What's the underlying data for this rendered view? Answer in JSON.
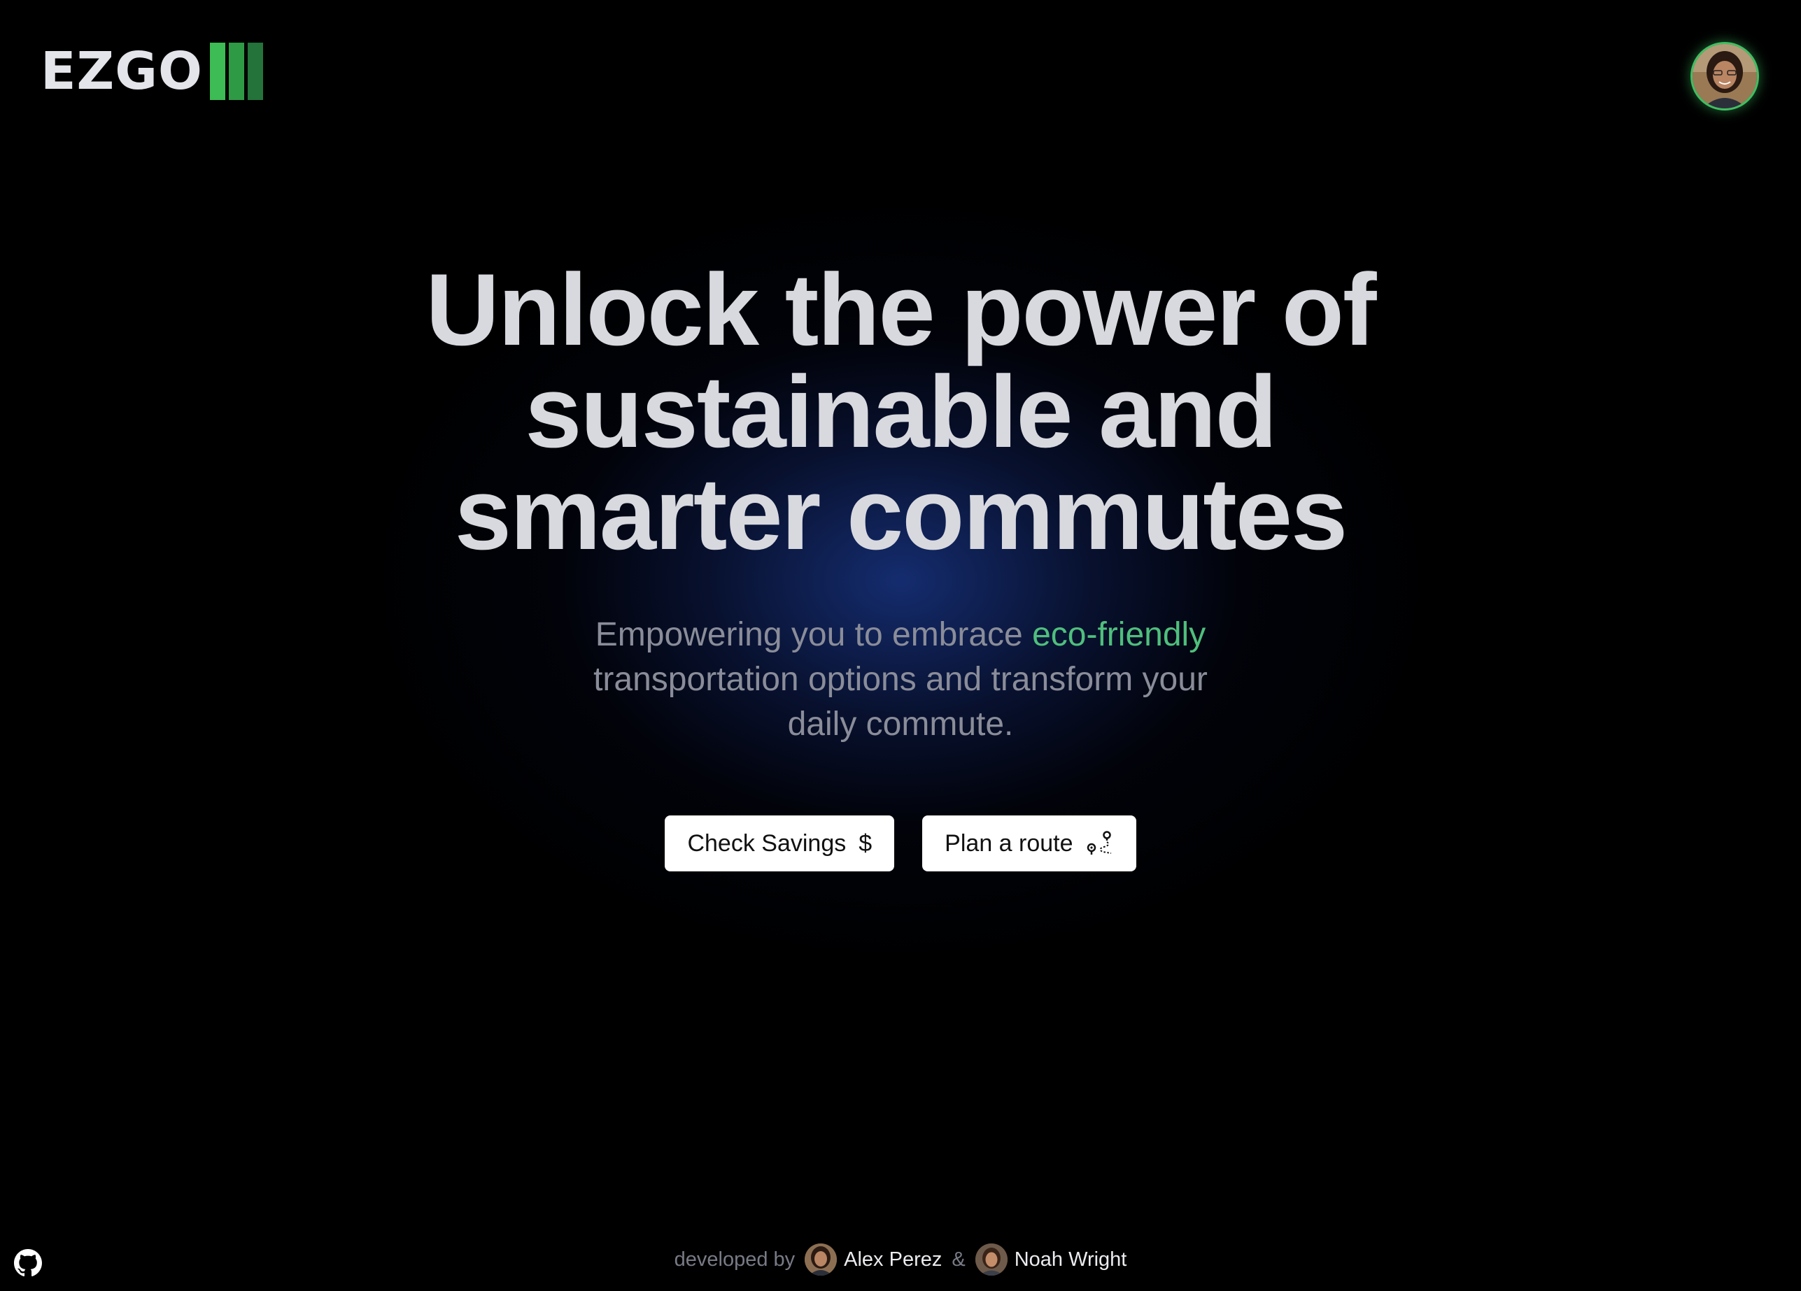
{
  "header": {
    "logo_text": "EZGO",
    "logo_bar_colors": [
      "#3dbb55",
      "#2f9a45",
      "#23733a"
    ],
    "avatar_icon": "user-avatar"
  },
  "hero": {
    "title_lines": [
      "Unlock the power of",
      "sustainable and",
      "smarter commutes"
    ],
    "subtitle_before": "Empowering you to embrace ",
    "subtitle_accent": "eco-friendly",
    "subtitle_line2": "transportation options and transform your",
    "subtitle_line3": "daily commute.",
    "accent_color": "#4fbf7d"
  },
  "buttons": {
    "check_savings": {
      "label": "Check Savings",
      "icon": "$"
    },
    "plan_route": {
      "label": "Plan a route",
      "icon": "route-icon"
    }
  },
  "footer": {
    "developed_by": "developed by",
    "separator": "&",
    "developers": [
      {
        "name": "Alex Perez"
      },
      {
        "name": "Noah Wright"
      }
    ],
    "github_icon": "github-icon"
  }
}
